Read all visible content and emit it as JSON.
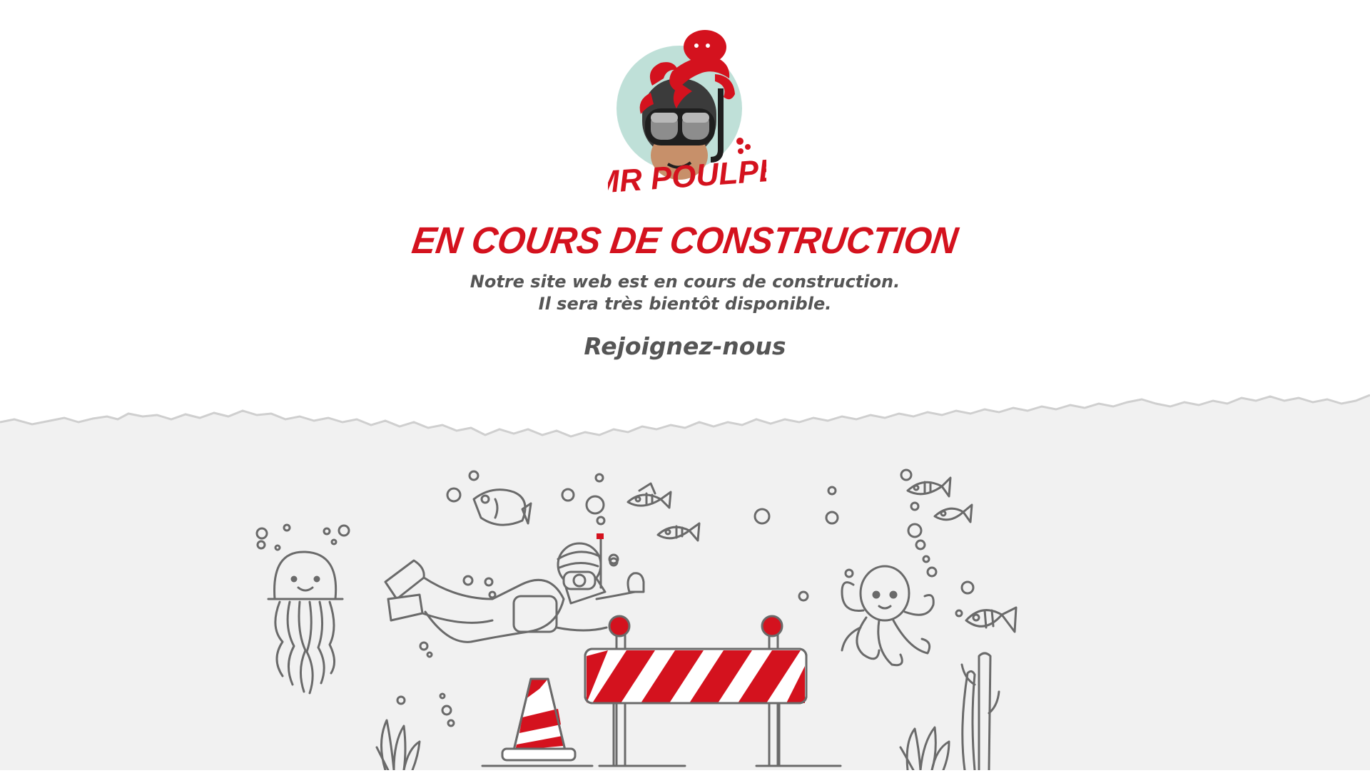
{
  "brand": {
    "logo_text": "MR POULPE"
  },
  "hero": {
    "headline": "En cours de construction",
    "subtitle_line1": "Notre site web est en cours de construction.",
    "subtitle_line2": "Il sera très bientôt disponible.",
    "join_label": "Rejoignez-nous"
  },
  "colors": {
    "brand_red": "#d4121e",
    "text_gray": "#555555",
    "line_gray": "#6a6a6a",
    "background_light": "#f1f1f1",
    "logo_circle": "#bfe0d8"
  },
  "illustration": {
    "icons": [
      "jellyfish-icon",
      "diver-icon",
      "fish-icon",
      "octopus-icon",
      "traffic-cone-icon",
      "road-barrier-icon",
      "seaweed-icon",
      "coral-icon",
      "bubble-icon"
    ]
  }
}
